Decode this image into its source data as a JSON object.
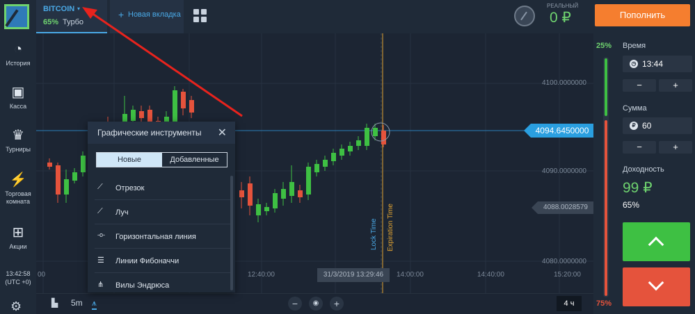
{
  "topbar": {
    "asset_name": "BITCOIN",
    "asset_dropdown_glyph": "▾",
    "asset_payout": "65%",
    "asset_mode": "Турбо",
    "new_tab_plus": "+",
    "new_tab_label": "Новая вкладка",
    "balance_label": "РЕАЛЬНЫЙ",
    "balance_value": "0 ₽",
    "deposit_label": "Пополнить"
  },
  "sidebar": {
    "items": [
      {
        "label": "История",
        "icon": "history-icon",
        "glyph": "◔"
      },
      {
        "label": "Касса",
        "icon": "wallet-icon",
        "glyph": "▣"
      },
      {
        "label": "Турниры",
        "icon": "trophy-icon",
        "glyph": "♛"
      },
      {
        "label": "Торговая комната",
        "icon": "trading-room-icon",
        "glyph": "⚡"
      },
      {
        "label": "Акции",
        "icon": "gift-icon",
        "glyph": "⊞"
      }
    ],
    "time": "13:42:58",
    "timezone": "(UTC +0)",
    "gear_glyph": "⚙"
  },
  "chart": {
    "price_levels": [
      "4100.0000000",
      "4090.0000000",
      "4080.0000000"
    ],
    "current_price": "4094.6450000",
    "second_price": "4088.0028579",
    "time_labels": [
      "00",
      "12:40:00",
      "14:00:00",
      "14:40:00",
      "15:20:00"
    ],
    "date_cursor": "31/3/2019 13:29:46",
    "lock_time_label": "Lock Time",
    "expiration_label": "Expiration Time"
  },
  "chart_data": {
    "type": "candlestick",
    "up_color": "#3ec043",
    "down_color": "#e5533c"
  },
  "bottombar": {
    "candle_icon": "candles-icon",
    "timeframe": "5m",
    "tools_icon": "drawing-tools-icon",
    "zoom_out": "−",
    "zoom_reset": "◉",
    "zoom_in": "+",
    "period": "4 ч"
  },
  "popup": {
    "title": "Графические инструменты",
    "close": "✕",
    "tab_new": "Новые",
    "tab_added": "Добавленные",
    "tools": [
      {
        "label": "Отрезок",
        "glyph": "⟋"
      },
      {
        "label": "Луч",
        "glyph": "⟋"
      },
      {
        "label": "Горизонтальная линия",
        "glyph": "-o-"
      },
      {
        "label": "Линии Фибоначчи",
        "glyph": "☰"
      },
      {
        "label": "Вилы Эндрюса",
        "glyph": "⋔"
      }
    ]
  },
  "rpanel": {
    "up_pct": "25%",
    "down_pct": "75%",
    "up_fraction": 0.25,
    "time_label": "Время",
    "time_value": "13:44",
    "amount_label": "Сумма",
    "amount_value": "60",
    "amount_icon": "₽",
    "minus": "−",
    "plus": "+",
    "profit_label": "Доходность",
    "profit_value": "99 ₽",
    "profit_pct": "65%"
  },
  "colors": {
    "accent": "#4aa9e6",
    "green": "#3ec043",
    "red": "#e5533c",
    "orange": "#f57e2f",
    "background": "#1c2533"
  }
}
